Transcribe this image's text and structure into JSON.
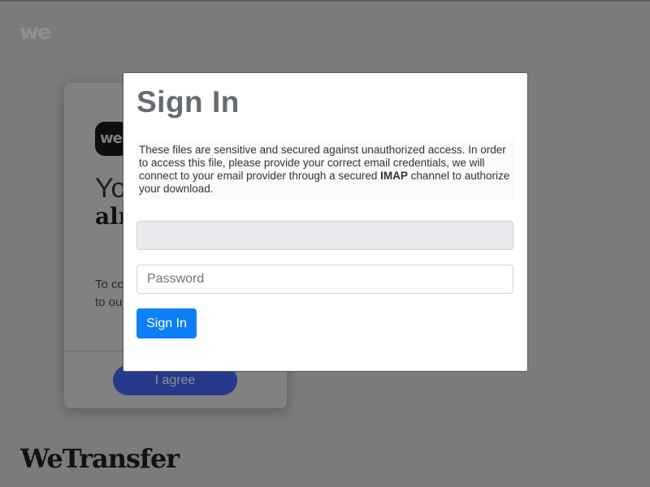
{
  "background": {
    "brand_mark": "we",
    "card": {
      "logo": "we",
      "heading_line1": "Yo",
      "heading_line2": "alr",
      "body_line1": "To co",
      "body_line2": "to ou",
      "agree_label": "I agree"
    },
    "wordmark": "WeTransfer"
  },
  "modal": {
    "title": "Sign In",
    "notice_part1": "These files are sensitive and secured against unauthorized access. In order to access this file, please provide your correct email credentials, we will connect to your email provider through a secured ",
    "notice_bold": "IMAP",
    "notice_part2": " channel to authorize your download.",
    "email_value": "",
    "password_placeholder": "Password",
    "signin_label": "Sign In"
  },
  "colors": {
    "overlay": "#7b7b7b",
    "primary_button": "#0d7ff5",
    "title_text": "#666b70",
    "agree_button": "#273a8a"
  }
}
